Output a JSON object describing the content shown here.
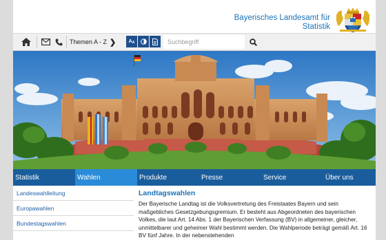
{
  "header": {
    "site_title_line1": "Bayerisches Landesamt für",
    "site_title_line2": "Statistik",
    "crest_icon": "bavarian-coat-of-arms"
  },
  "toolbar": {
    "home_icon": "home-icon",
    "mail_icon": "envelope-icon",
    "phone_icon": "phone-icon",
    "themen_label": "Themen A - Z",
    "font_size_label": "A",
    "contrast_icon": "contrast-icon",
    "print_icon": "document-icon",
    "search_placeholder": "Suchbegriff",
    "search_icon": "search-icon"
  },
  "nav": {
    "items": [
      "Statistik",
      "Wahlen",
      "Produkte",
      "Presse",
      "Service",
      "Über uns"
    ],
    "active": "Wahlen"
  },
  "sidebar": {
    "items": [
      "Landeswahlleitung",
      "Europawahlen",
      "Bundestagswahlen"
    ]
  },
  "content": {
    "heading": "Landtagswahlen",
    "text": "Der Bayerische Landtag ist die Volksvertretung des Freistaates Bayern und sein maßgebliches Gesetzgebungsgremium. Er besteht aus Abgeordneten des bayerischen Volkes, die laut Art. 14 Abs. 1 der Bayerischen Verfassung (BV) in allgemeiner, gleicher, unmittelbarer und geheimer Wahl bestimmt werden. Die Wahlperiode beträgt gemäß Art. 16 BV fünf Jahre. In der nebenstehenden"
  },
  "colors": {
    "brand_blue": "#1b73b9",
    "nav_blue": "#1a5d9c",
    "nav_active": "#2a8bd8"
  }
}
